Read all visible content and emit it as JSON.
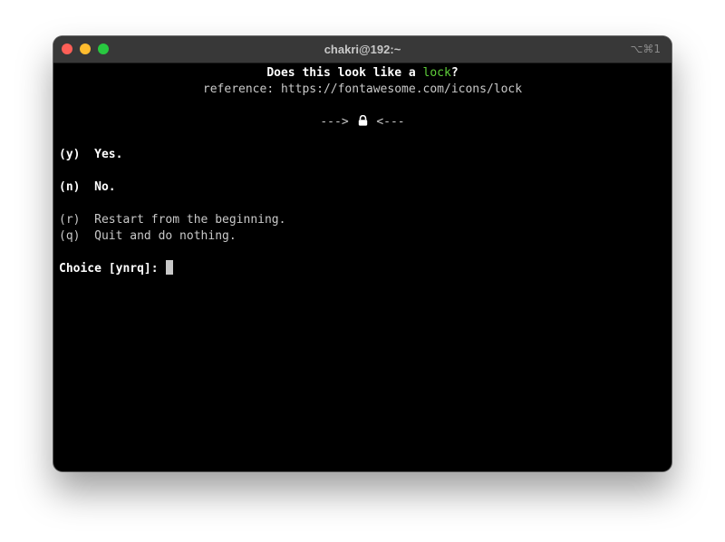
{
  "window": {
    "title": "chakri@192:~",
    "shortcut": "⌥⌘1"
  },
  "terminal": {
    "question_prefix": "Does this look like a ",
    "icon_name": "lock",
    "question_suffix": "?",
    "reference": "reference: https://fontawesome.com/icons/lock",
    "arrow_left": "--->",
    "arrow_right": "<---",
    "options": [
      {
        "key": "(y)",
        "label": "Yes."
      },
      {
        "key": "(n)",
        "label": "No."
      },
      {
        "key": "(r)",
        "label": "Restart from the beginning."
      },
      {
        "key": "(q)",
        "label": "Quit and do nothing."
      }
    ],
    "prompt": "Choice [ynrq]: "
  },
  "colors": {
    "accent_green": "#5fcf3a",
    "close": "#fe5f57",
    "minimize": "#febc2e",
    "maximize": "#28c840"
  }
}
